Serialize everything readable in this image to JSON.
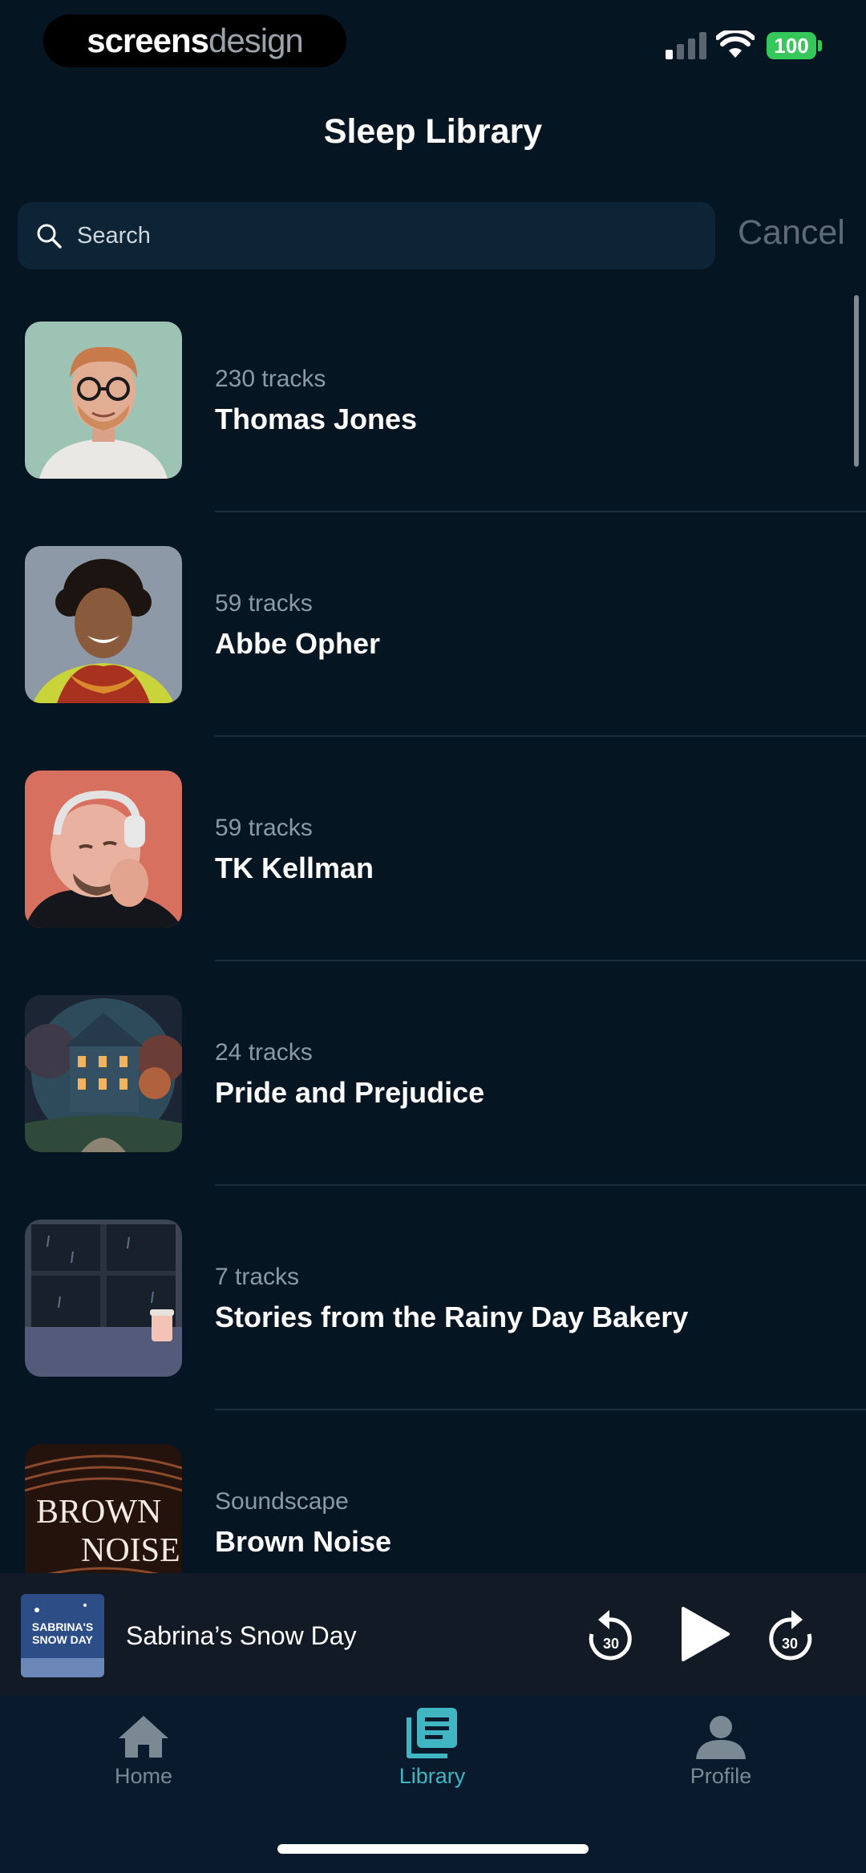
{
  "status_bar": {
    "brand_primary": "screens",
    "brand_secondary": "design",
    "battery": "100",
    "battery_color": "#35c759"
  },
  "header": {
    "title": "Sleep Library",
    "search_placeholder": "Search",
    "search_value": "",
    "cancel_label": "Cancel"
  },
  "library": {
    "items": [
      {
        "meta": "230 tracks",
        "title": "Thomas Jones",
        "image": "portrait-thomas-jones"
      },
      {
        "meta": "59 tracks",
        "title": "Abbe Opher",
        "image": "portrait-abbe-opher"
      },
      {
        "meta": "59 tracks",
        "title": "TK Kellman",
        "image": "portrait-tk-kellman"
      },
      {
        "meta": "24 tracks",
        "title": "Pride and Prejudice",
        "image": "artwork-manor-house"
      },
      {
        "meta": "7 tracks",
        "title": "Stories from the Rainy Day Bakery",
        "image": "artwork-rainy-window"
      },
      {
        "meta": "Soundscape",
        "title": "Brown Noise",
        "image": "artwork-brown-noise",
        "art_line1": "BROWN",
        "art_line2": "NOISE"
      }
    ]
  },
  "mini_player": {
    "title": "Sabrina’s Snow Day",
    "art_line1": "SABRINA'S",
    "art_line2": "SNOW DAY",
    "rewind_seconds": "30",
    "forward_seconds": "30"
  },
  "tab_bar": {
    "tabs": [
      {
        "label": "Home",
        "icon": "home-icon"
      },
      {
        "label": "Library",
        "icon": "library-icon",
        "active": true
      },
      {
        "label": "Profile",
        "icon": "profile-icon"
      }
    ],
    "active_color": "#3fb6c2",
    "inactive_color": "#7b8994"
  },
  "theme": {
    "background": "#061522",
    "accent": "#3fb6c2"
  }
}
